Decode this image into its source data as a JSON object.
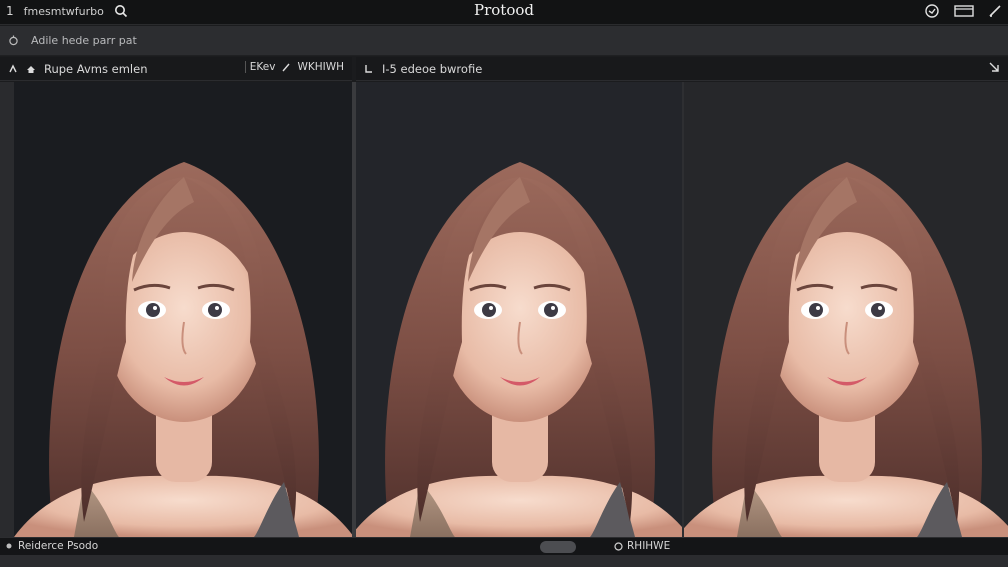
{
  "topbar": {
    "menu_number": "1",
    "menu_label": "fmesmtwfurbo",
    "app_title": "Protood"
  },
  "subbar": {
    "path_text": "Adile hede parr pat"
  },
  "left_panel": {
    "title": "Rupe Avms emlen",
    "tool_label_1": "EKev",
    "tool_label_2": "WKHIWH"
  },
  "right_panel": {
    "title": "I-5 edeoe bwrofie"
  },
  "footer": {
    "left_label": "Reiderce Psodo",
    "right_label": "RHIHWE"
  },
  "colors": {
    "hair": "#8a5a4e",
    "skin": "#f2d2c2",
    "lips": "#d45a68",
    "background": "#1b1c1e"
  },
  "icons": {
    "search": "search-icon",
    "refresh": "refresh-icon",
    "window": "window-icon",
    "pencil": "pencil-icon",
    "collapse": "collapse-icon",
    "lock": "lock-icon"
  }
}
